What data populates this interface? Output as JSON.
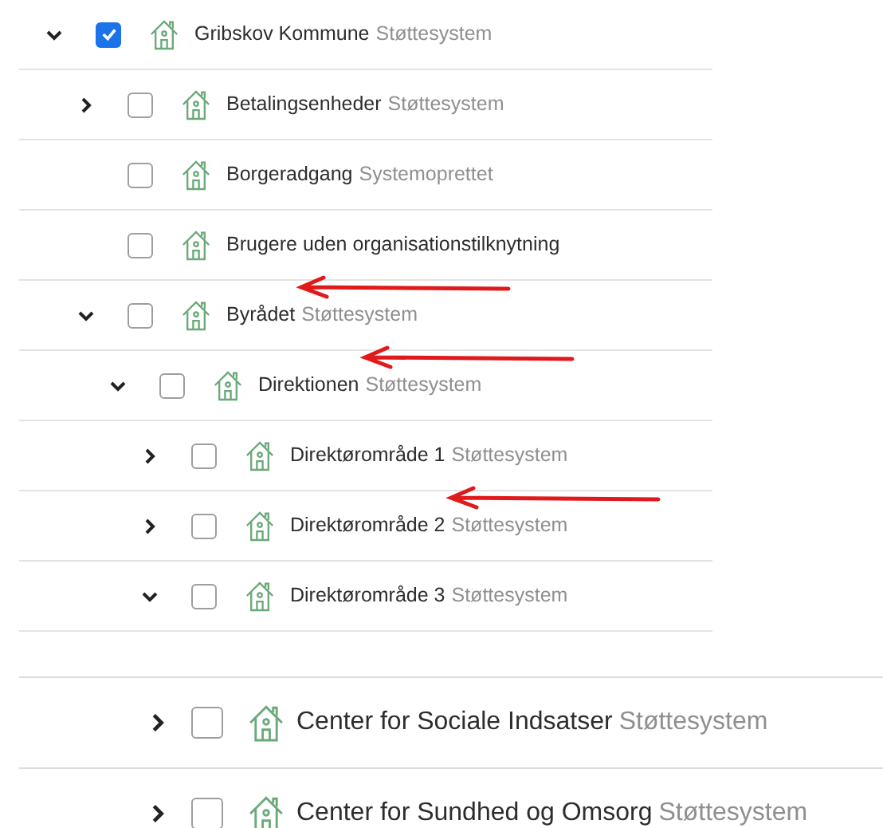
{
  "tree": [
    {
      "name": "Gribskov Kommune",
      "tag": "Støttesystem",
      "kind": "branch",
      "expanded": true,
      "checked": true,
      "marked": false,
      "children": [
        {
          "name": "Betalingsenheder",
          "tag": "Støttesystem",
          "kind": "branch",
          "expanded": false,
          "checked": false,
          "marked": false
        },
        {
          "name": "Borgeradgang",
          "tag": "Systemoprettet",
          "kind": "leaf",
          "checked": false,
          "marked": false
        },
        {
          "name": "Brugere uden organisationstilknytning",
          "kind": "leaf",
          "checked": false,
          "marked": false
        },
        {
          "name": "Byrådet",
          "tag": "Støttesystem",
          "kind": "branch",
          "expanded": true,
          "checked": false,
          "marked": true,
          "children": [
            {
              "name": "Direktionen",
              "tag": "Støttesystem",
              "kind": "branch",
              "expanded": true,
              "checked": false,
              "marked": true,
              "children": [
                {
                  "name": "Direktørområde 1",
                  "tag": "Støttesystem",
                  "kind": "branch",
                  "expanded": false,
                  "checked": false,
                  "marked": false
                },
                {
                  "name": "Direktørområde 2",
                  "tag": "Støttesystem",
                  "kind": "branch",
                  "expanded": false,
                  "checked": false,
                  "marked": true
                },
                {
                  "name": "Direktørområde 3",
                  "tag": "Støttesystem",
                  "kind": "branch",
                  "expanded": true,
                  "checked": false,
                  "marked": false
                }
              ]
            }
          ]
        }
      ]
    }
  ],
  "zoomed_list": [
    {
      "name": "Center for Sociale Indsatser",
      "tag": "Støttesystem",
      "kind": "branch",
      "expanded": false,
      "checked": false
    },
    {
      "name": "Center for Sundhed og Omsorg",
      "tag": "Støttesystem",
      "kind": "branch",
      "expanded": false,
      "checked": false
    }
  ]
}
